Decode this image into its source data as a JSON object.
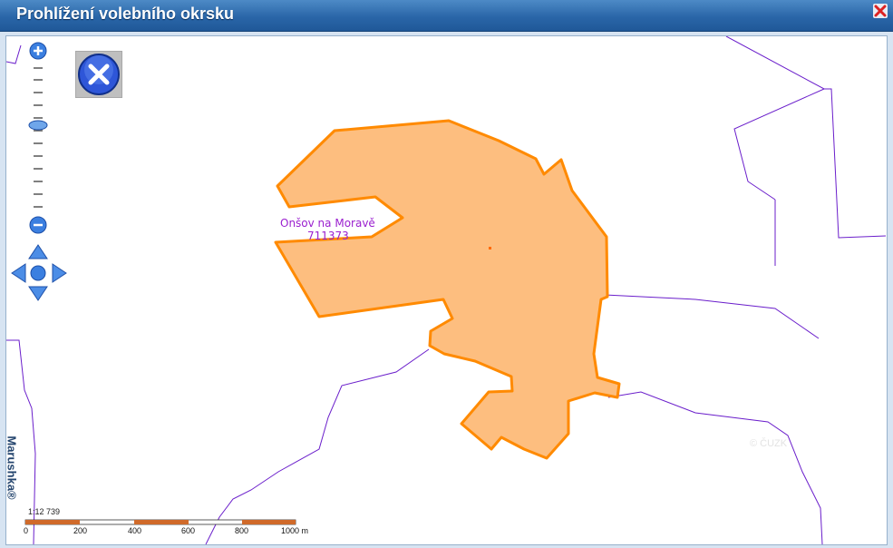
{
  "window": {
    "title": "Prohlížení volebního okrsku"
  },
  "map": {
    "district_name": "Onšov na Moravě",
    "district_code": "711373",
    "copyright": "© ČUZK",
    "brand": "Marushka®",
    "scale_ratio": "1:12 739",
    "scale_labels": [
      "0",
      "200",
      "400",
      "600",
      "800",
      "1000 m"
    ],
    "colors": {
      "district_fill": "#fdbe7f",
      "district_stroke": "#ff8a00",
      "boundary": "#6a1ecb"
    }
  },
  "controls": {
    "zoom_in": "zoom-in-icon",
    "zoom_out": "zoom-out-icon",
    "close": "close-map-icon",
    "pan": "pan-arrows-icon"
  }
}
